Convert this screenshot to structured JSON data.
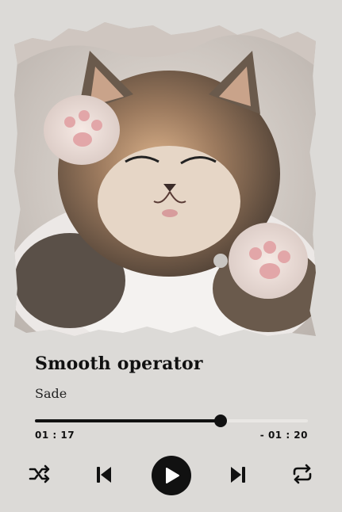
{
  "track": {
    "title": "Smooth operator",
    "artist": "Sade",
    "artwork_icon": "kitten-photo"
  },
  "playback": {
    "elapsed": "01 : 17",
    "remaining": "- 01 : 20",
    "progress_fraction": 0.68
  },
  "controls": {
    "shuffle_icon": "shuffle-icon",
    "previous_icon": "skip-previous-icon",
    "play_icon": "play-icon",
    "next_icon": "skip-next-icon",
    "repeat_icon": "repeat-icon"
  },
  "colors": {
    "background": "#dcdad7",
    "accent": "#111111",
    "track": "#e9e7e4"
  }
}
